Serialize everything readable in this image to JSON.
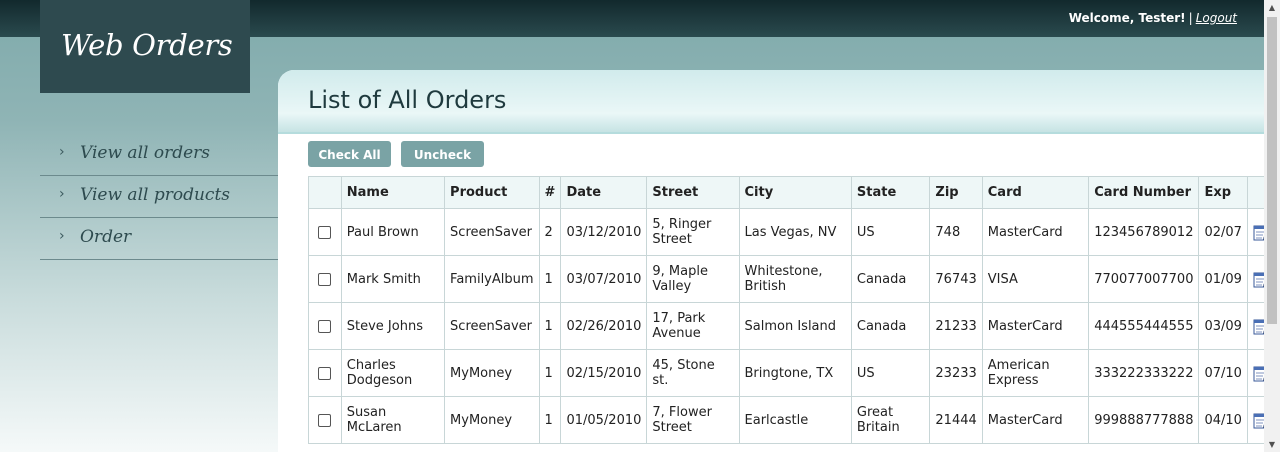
{
  "header": {
    "welcome": "Welcome, Tester!",
    "separator": "|",
    "logout": "Logout"
  },
  "logo": "Web Orders",
  "sidebar": {
    "items": [
      {
        "label": "View all orders"
      },
      {
        "label": "View all products"
      },
      {
        "label": "Order"
      }
    ]
  },
  "main": {
    "title": "List of All Orders",
    "check_all": "Check All",
    "uncheck_all": "Uncheck All"
  },
  "table": {
    "columns": [
      "Name",
      "Product",
      "#",
      "Date",
      "Street",
      "City",
      "State",
      "Zip",
      "Card",
      "Card Number",
      "Exp"
    ],
    "rows": [
      [
        "Paul Brown",
        "ScreenSaver",
        "2",
        "03/12/2010",
        "5, Ringer Street",
        "Las Vegas, NV",
        "US",
        "748",
        "MasterCard",
        "123456789012",
        "02/07"
      ],
      [
        "Mark Smith",
        "FamilyAlbum",
        "1",
        "03/07/2010",
        "9, Maple Valley",
        "Whitestone, British",
        "Canada",
        "76743",
        "VISA",
        "770077007700",
        "01/09"
      ],
      [
        "Steve Johns",
        "ScreenSaver",
        "1",
        "02/26/2010",
        "17, Park Avenue",
        "Salmon Island",
        "Canada",
        "21233",
        "MasterCard",
        "444555444555",
        "03/09"
      ],
      [
        "Charles Dodgeson",
        "MyMoney",
        "1",
        "02/15/2010",
        "45, Stone st.",
        "Bringtone, TX",
        "US",
        "23233",
        "American Express",
        "333222333222",
        "07/10"
      ],
      [
        "Susan McLaren",
        "MyMoney",
        "1",
        "01/05/2010",
        "7, Flower Street",
        "Earlcastle",
        "Great Britain",
        "21444",
        "MasterCard",
        "999888777888",
        "04/10"
      ]
    ]
  },
  "icons": {
    "edit": "edit-icon",
    "nav": "chevron-right-icon"
  },
  "colors": {
    "topbar": "#1e3a3e",
    "logo_bg": "#2e4a4f",
    "button": "#7aa3a5"
  }
}
